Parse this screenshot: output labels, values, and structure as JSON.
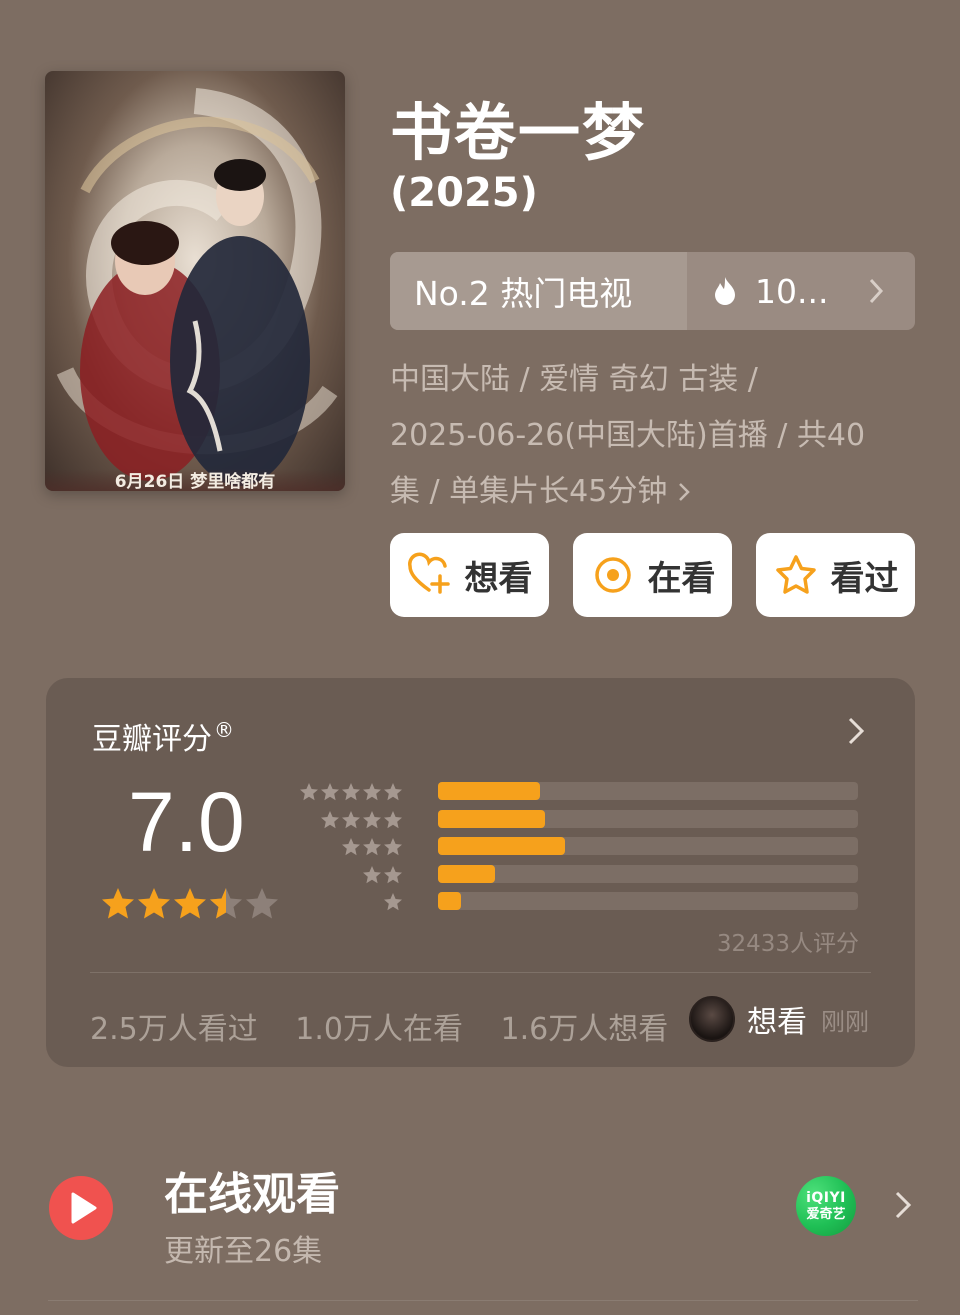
{
  "header": {
    "title": "书卷一梦",
    "year": "(2025)",
    "poster_caption": "6月26日 梦里啥都有",
    "ranking": {
      "label": "No.2 热门电视",
      "heat": "10..."
    },
    "meta_lines": [
      "中国大陆 / 爱情 奇幻 古装 /",
      "2025-06-26(中国大陆)首播 / 共40",
      "集 / 单集片长45分钟"
    ]
  },
  "actions": [
    {
      "label": "想看",
      "icon": "heart-plus-icon"
    },
    {
      "label": "在看",
      "icon": "target-icon"
    },
    {
      "label": "看过",
      "icon": "star-outline-icon"
    }
  ],
  "rating": {
    "label": "豆瓣评分",
    "mark": "®",
    "score": "7.0",
    "score_value": 7.0,
    "star_fraction": 0.35,
    "distribution": [
      {
        "stars": 5,
        "percent": 24.3
      },
      {
        "stars": 4,
        "percent": 25.5
      },
      {
        "stars": 3,
        "percent": 30.2
      },
      {
        "stars": 2,
        "percent": 13.6
      },
      {
        "stars": 1,
        "percent": 5.4
      }
    ],
    "count_text": "32433人评分",
    "stats": [
      "2.5万人看过",
      "1.0万人在看",
      "1.6万人想看"
    ],
    "recent_action": "想看",
    "recent_time": "刚刚"
  },
  "online": {
    "title": "在线观看",
    "subtitle": "更新至26集",
    "platform": {
      "line1": "iQIYI",
      "line2": "爱奇艺"
    }
  },
  "colors": {
    "background": "#7d6d62",
    "card": "#6a5c53",
    "accent_orange": "#f6a11c",
    "play_red": "#f0524f",
    "iqiyi_green": "#1fbf55"
  }
}
